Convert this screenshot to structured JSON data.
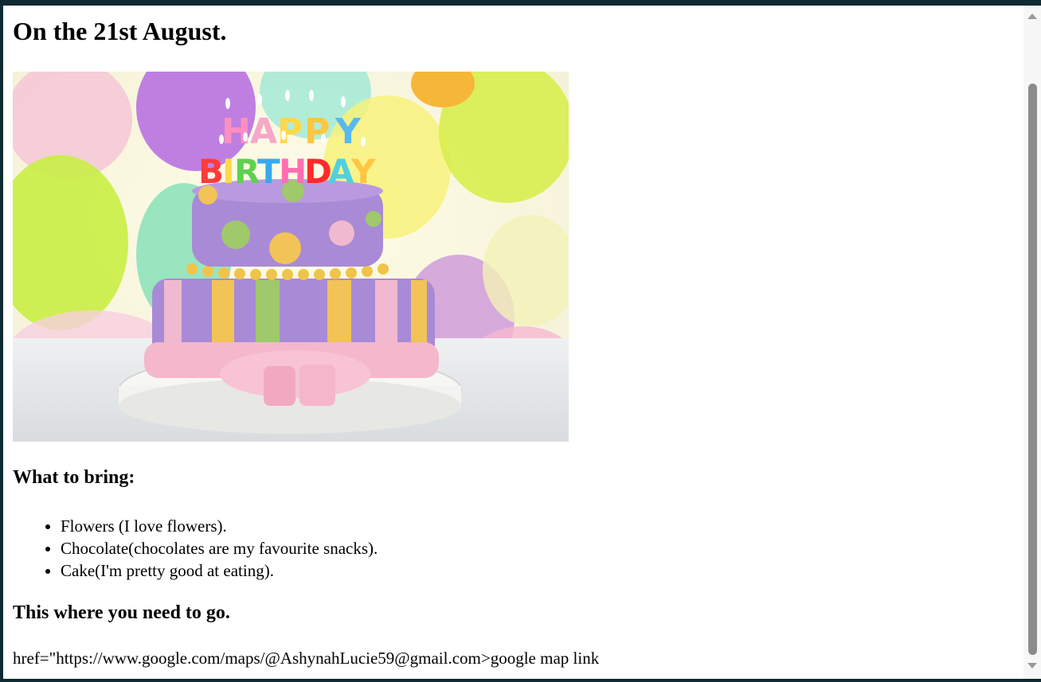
{
  "page": {
    "title": "On the 21st August.",
    "image_alt": "HAPPY BIRTHDAY",
    "image_candle_text_top": "HAPPY",
    "image_candle_text_bottom": "BIRTHDAY",
    "bring_heading": "What to bring:",
    "bring_items": [
      "Flowers (I love flowers).",
      "Chocolate(chocolates are my favourite snacks).",
      "Cake(I'm pretty good at eating)."
    ],
    "go_heading": "This where you need to go.",
    "map_text": "href=\"https://www.google.com/maps/@AshynahLucie59@gmail.com>google map link"
  },
  "icons": {
    "scroll_up": "chevron-up-icon",
    "scroll_down": "chevron-down-icon"
  }
}
